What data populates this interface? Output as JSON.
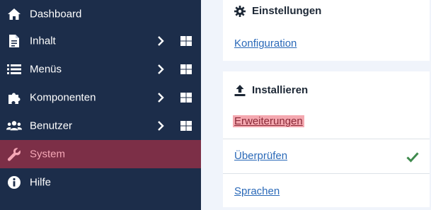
{
  "sidebar": {
    "items": [
      {
        "label": "Dashboard",
        "icon": "home-icon",
        "has_chevron": false,
        "has_grid": false
      },
      {
        "label": "Inhalt",
        "icon": "document-icon",
        "has_chevron": true,
        "has_grid": true
      },
      {
        "label": "Menüs",
        "icon": "list-icon",
        "has_chevron": true,
        "has_grid": true
      },
      {
        "label": "Komponenten",
        "icon": "puzzle-icon",
        "has_chevron": true,
        "has_grid": true
      },
      {
        "label": "Benutzer",
        "icon": "users-icon",
        "has_chevron": true,
        "has_grid": true
      },
      {
        "label": "System",
        "icon": "wrench-icon",
        "active": true
      },
      {
        "label": "Hilfe",
        "icon": "info-icon"
      }
    ]
  },
  "main": {
    "settings_card": {
      "title": "Einstellungen",
      "links": [
        "Konfiguration"
      ]
    },
    "install_card": {
      "title": "Installieren",
      "links": [
        {
          "label": "Erweiterungen",
          "highlighted": true
        },
        {
          "label": "Überprüfen",
          "status": "check-icon"
        },
        {
          "label": "Sprachen"
        }
      ]
    }
  },
  "colors": {
    "sidebar_bg": "#1c2d4a",
    "active_bg": "#7c2f47",
    "active_text": "#f5a7b6",
    "link": "#2a69b8",
    "check": "#3f8a4d"
  }
}
